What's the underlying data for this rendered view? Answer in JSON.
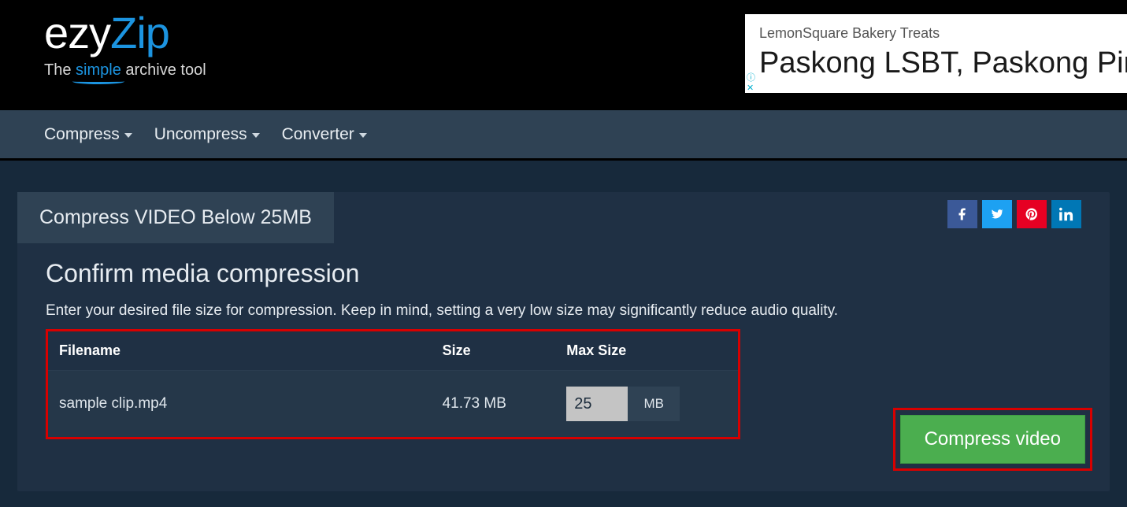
{
  "logo": {
    "part1": "ezy",
    "part2": "Zip",
    "tag_pre": "The ",
    "tag_em": "simple",
    "tag_post": " archive tool"
  },
  "ad": {
    "kicker": "LemonSquare Bakery Treats",
    "headline": "Paskong LSBT, Paskong Pin"
  },
  "nav": {
    "items": [
      "Compress",
      "Uncompress",
      "Converter"
    ]
  },
  "tab": {
    "label": "Compress VIDEO Below 25MB"
  },
  "heading": "Confirm media compression",
  "subtext": "Enter your desired file size for compression. Keep in mind, setting a very low size may significantly reduce audio quality.",
  "table": {
    "headers": {
      "filename": "Filename",
      "size": "Size",
      "maxsize": "Max Size"
    },
    "row": {
      "filename": "sample clip.mp4",
      "size": "41.73 MB",
      "max_value": "25",
      "max_unit": "MB"
    }
  },
  "cta": {
    "label": "Compress video"
  }
}
